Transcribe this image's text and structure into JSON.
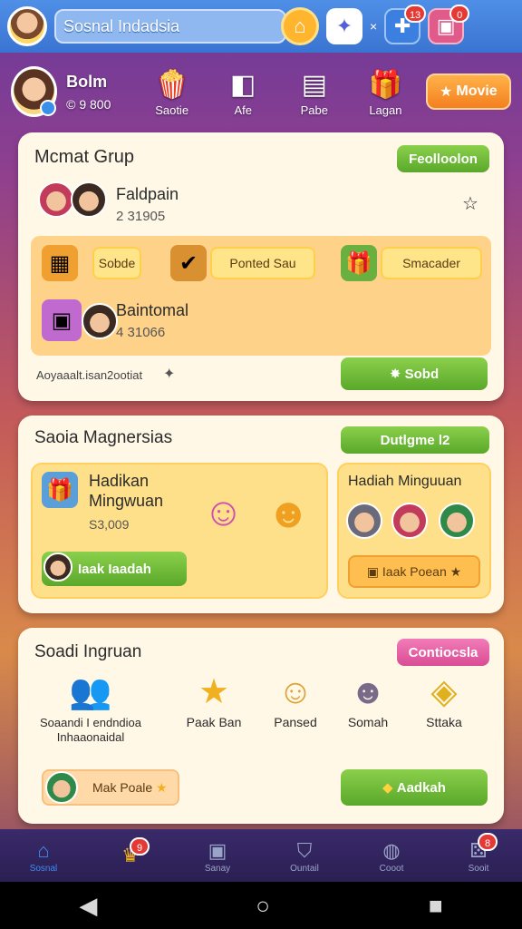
{
  "topbar": {
    "search_value": "Sosnal Indadsia",
    "icons": [
      "home-icon",
      "game-controller-icon",
      "puzzle-icon",
      "chat-icon"
    ],
    "x_label": "×",
    "badge_puzzle": "13",
    "badge_chat": "0"
  },
  "profile": {
    "name": "Bolm",
    "coins": "© 9 800",
    "menu": [
      {
        "label": "Saotie",
        "icon": "popcorn-icon"
      },
      {
        "label": "Afe",
        "icon": "cube-icon"
      },
      {
        "label": "Pabe",
        "icon": "basket-icon"
      },
      {
        "label": "Lagan",
        "icon": "gift-icon"
      }
    ],
    "mode_button": "Movie"
  },
  "card1": {
    "title": "Mcmat Grup",
    "pill": "Feolloolon",
    "group1_name": "Faldpain",
    "group1_count": "2 31905",
    "tags": [
      "Sobde",
      "Ponted Sau",
      "Smacader"
    ],
    "group2_name": "Baintomal",
    "group2_count": "4 31066",
    "footer_text": "Aoyaaalt.isan2ootiat",
    "footer_icon": "pin-icon",
    "action_button": "Sobd"
  },
  "card2": {
    "title": "Saoia Magnersias",
    "pill": "Dutlgme l2",
    "left_title_1": "Hadikan",
    "left_title_2": "Mingwuan",
    "left_amount": "S3,009",
    "left_button": "Iaak Iaadah",
    "right_title": "Hadiah Minguuan",
    "right_button": "Iaak Poean"
  },
  "card3": {
    "title": "Soadi Ingruan",
    "pill": "Contiocsla",
    "items": [
      {
        "label": "Soaandi I endndioa\nInhaaonaidal",
        "icon": "friends-icon"
      },
      {
        "label": "Paak Ban",
        "icon": "star-block-icon"
      },
      {
        "label": "Pansed",
        "icon": "hooded-avatar-icon"
      },
      {
        "label": "Somah",
        "icon": "girl-avatar-icon"
      },
      {
        "label": "Sttaka",
        "icon": "gold-ticket-icon"
      }
    ],
    "left_button": "Mak Poale",
    "action_button": "Aadkah"
  },
  "bottom_nav": [
    {
      "label": "Sosnal",
      "icon": "home-icon",
      "active": true
    },
    {
      "label": "",
      "icon": "trophy-icon",
      "badge": "9"
    },
    {
      "label": "Sanay",
      "icon": "camera-icon"
    },
    {
      "label": "Ountail",
      "icon": "shield-icon"
    },
    {
      "label": "Cooot",
      "icon": "globe-icon"
    },
    {
      "label": "Sooit",
      "icon": "dice-icon",
      "badge": "8"
    }
  ],
  "system_bar": {
    "back": "◀",
    "home": "○",
    "recent": "■"
  },
  "colors": {
    "topbar": "#3a74d2",
    "card": "#fff8e7",
    "green": "#5aa82a",
    "pink": "#d94c94",
    "orange": "#f4801e"
  }
}
